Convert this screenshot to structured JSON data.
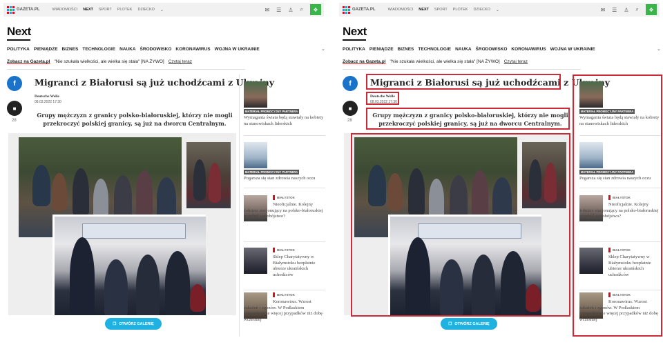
{
  "site": {
    "logo": "GAZETA.PL",
    "nav": [
      "WIADOMOŚCI",
      "NEXT",
      "SPORT",
      "PLOTEK",
      "DZIECKO"
    ],
    "nav_active": "NEXT",
    "nav_chevron": "chevron-down-icon",
    "tools": [
      "mail-icon",
      "chat-icon",
      "user-icon",
      "search-icon",
      "gift-icon"
    ],
    "brand": "Next"
  },
  "categories": [
    "POLITYKA",
    "PIENIĄDZE",
    "BIZNES",
    "TECHNOLOGIE",
    "NAUKA",
    "ŚRODOWISKO",
    "KORONAWIRUS",
    "WOJNA W UKRAINIE"
  ],
  "promo": {
    "see": "Zobacz na Gazeta.pl",
    "quote": "\"Nie szukała wielkości, ale wielka się stała\" [NA ŻYWO]",
    "read": "Czytaj teraz"
  },
  "article": {
    "title": "Migranci z Białorusi są już uchodźcami z Ukrainy",
    "author": "Deutsche Welle",
    "date": "08.03.2022 17:30",
    "lead": "Grupy mężczyzn z granicy polsko-białoruskiej, którzy nie mogli przekroczyć polskiej granicy, są już na dworcu Centralnym.",
    "comments": "28",
    "gallery_button": "OTWÓRZ GALERIĘ"
  },
  "sidebar": [
    {
      "tag": "MATERIAŁ PROMOCYJNY PARTNERA",
      "title": "Wymagania świata będą stawiały na kobiety na stanowiskach liderskich"
    },
    {
      "tag": "MATERIAŁ PROMOCYJNY PARTNERA",
      "title": "Pogarsza się stan zdrowia naszych oczu"
    },
    {
      "city": "BIAŁYSTOK",
      "title": "Nieoficjalnie. Kolejny żołnierz stacjonujący na polsko-białoruskiej popełnił samobójstwo?"
    },
    {
      "city": "BIAŁYSTOK",
      "title": "Sklep Charytatywny w Białymstoku bezpłatnie ubierze ukraińskich uchodźców"
    },
    {
      "city": "BIAŁYSTOK",
      "title": "Koronawirus. Wzrost zakażeń i zgonów. W Podlaskiem czternokrotnie więcej przypadków niż dobę wcześniej"
    }
  ],
  "colors": {
    "highlight": "#cc2a36",
    "facebook": "#1a73c8",
    "gallery_button": "#1fb2e0",
    "accent_green": "#3ab54a",
    "city_marker": "#d0141c"
  }
}
